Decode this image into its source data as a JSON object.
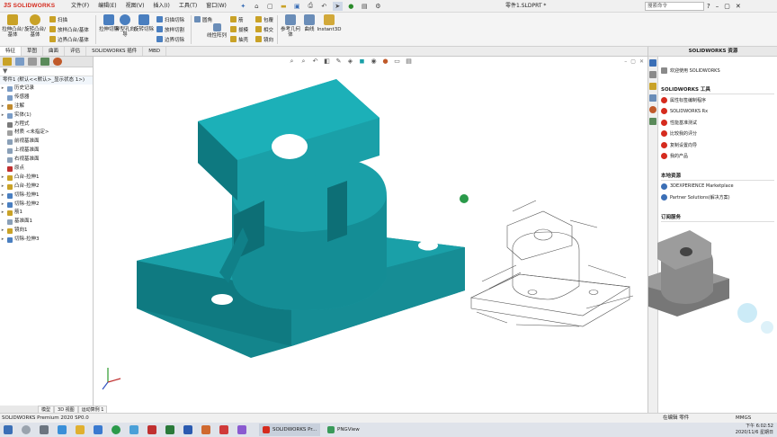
{
  "app": {
    "brand_prefix": "3S",
    "brand_name": "SOLIDWORKS",
    "document_title": "零件1.SLDPRT *",
    "search_placeholder": "搜索命令"
  },
  "menus": [
    "文件(F)",
    "编辑(E)",
    "视图(V)",
    "插入(I)",
    "工具(T)",
    "窗口(W)"
  ],
  "command_manager": {
    "big_buttons": [
      {
        "label": "拉伸凸台/基体",
        "color": "#c9a227"
      },
      {
        "label": "旋转凸台/基体",
        "color": "#c9a227"
      },
      {
        "label": "拉伸切除",
        "color": "#4a7fc0"
      },
      {
        "label": "异型孔向导",
        "color": "#4a7fc0"
      },
      {
        "label": "旋转切除",
        "color": "#4a7fc0"
      },
      {
        "label": "参考几何体",
        "color": "#6a8db8"
      },
      {
        "label": "曲线",
        "color": "#6a8db8"
      },
      {
        "label": "Instant3D",
        "color": "#d2a93a"
      }
    ],
    "small_buttons": [
      "扫描",
      "放样凸台/基体",
      "边界凸台/基体",
      "扫描切除",
      "放样切割",
      "边界切除",
      "圆角",
      "线性阵列",
      "筋",
      "拔模",
      "抽壳",
      "包覆",
      "相交",
      "镜向"
    ]
  },
  "tabs": [
    "特征",
    "草图",
    "曲面",
    "评估",
    "SOLIDWORKS 插件",
    "MBD"
  ],
  "feature_tree": {
    "root": "零件1 (默认<<默认>_显示状态 1>)",
    "items": [
      {
        "label": "历史记录",
        "expand": "▸",
        "color": "#7a9cc6"
      },
      {
        "label": "传感器",
        "expand": "",
        "color": "#7a9cc6"
      },
      {
        "label": "注解",
        "expand": "▸",
        "color": "#c08a2e"
      },
      {
        "label": "实体(1)",
        "expand": "▸",
        "color": "#7a9cc6"
      },
      {
        "label": "方程式",
        "expand": "",
        "color": "#7a7a7a"
      },
      {
        "label": "材质 <未指定>",
        "expand": "",
        "color": "#a0a0a0"
      },
      {
        "label": "前视基准面",
        "expand": "",
        "color": "#8aa0b8"
      },
      {
        "label": "上视基准面",
        "expand": "",
        "color": "#8aa0b8"
      },
      {
        "label": "右视基准面",
        "expand": "",
        "color": "#8aa0b8"
      },
      {
        "label": "原点",
        "expand": "",
        "color": "#c03030"
      },
      {
        "label": "凸台-拉伸1",
        "expand": "▸",
        "color": "#c9a227"
      },
      {
        "label": "凸台-拉伸2",
        "expand": "▸",
        "color": "#c9a227"
      },
      {
        "label": "切除-拉伸1",
        "expand": "▸",
        "color": "#4a7fc0"
      },
      {
        "label": "切除-拉伸2",
        "expand": "▸",
        "color": "#4a7fc0"
      },
      {
        "label": "筋1",
        "expand": "▸",
        "color": "#c9a227"
      },
      {
        "label": "基准面1",
        "expand": "",
        "color": "#8aa0b8"
      },
      {
        "label": "镜向1",
        "expand": "▸",
        "color": "#c9a227"
      },
      {
        "label": "切除-拉伸3",
        "expand": "▸",
        "color": "#4a7fc0"
      }
    ]
  },
  "task_pane": {
    "title": "SOLIDWORKS 资源",
    "welcome": "欢迎使用 SOLIDWORKS",
    "tools_heading": "SOLIDWORKS 工具",
    "tools": [
      "属性标签编制程序",
      "SOLIDWORKS Rx",
      "性能基准测试",
      "比较我的评分",
      "复制设置向导",
      "我的产品"
    ],
    "community_heading": "本地资源",
    "community": [
      "3DEXPERIENCE Marketplace",
      "Partner Solutions(解决方案)"
    ],
    "subscription_heading": "订阅服务"
  },
  "model_tabs": [
    "模型",
    "3D 视图",
    "运动算例 1"
  ],
  "status": {
    "left": "SOLIDWORKS Premium 2020 SP0.0",
    "editing": "在编辑 零件",
    "units": "MMGS"
  },
  "taskbar": {
    "apps": [
      "SOLIDWORKS Pr...",
      "PNGView"
    ],
    "time": "下午 6:02:52",
    "date": "2020/11/6 星期日"
  },
  "colors": {
    "model": "#1aa0a8",
    "model_shade": "#13858c",
    "model_dark": "#0d6f76",
    "accent_red": "#d52b1e"
  }
}
